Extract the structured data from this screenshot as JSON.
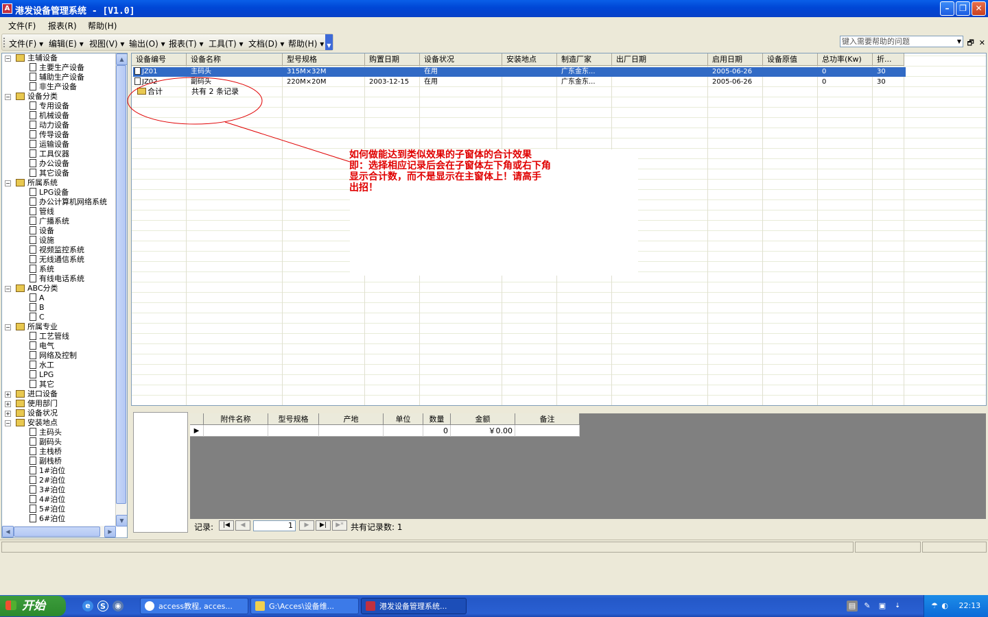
{
  "window": {
    "title": "港发设备管理系统 - [V1.0]",
    "app_icon_glyph": "A"
  },
  "menubar": {
    "items": [
      "文件(F)",
      "报表(R)",
      "帮助(H)"
    ],
    "help_placeholder": "键入需要帮助的问题"
  },
  "toolbar": {
    "items": [
      "文件(F)",
      "编辑(E)",
      "视图(V)",
      "输出(O)",
      "报表(T)",
      "工具(T)",
      "文档(D)",
      "帮助(H)"
    ]
  },
  "tree": [
    {
      "label": "主辅设备",
      "type": "folder",
      "expanded": true
    },
    {
      "label": "主要生产设备",
      "type": "doc"
    },
    {
      "label": "辅助生产设备",
      "type": "doc"
    },
    {
      "label": "非生产设备",
      "type": "doc"
    },
    {
      "label": "设备分类",
      "type": "folder",
      "expanded": true
    },
    {
      "label": "专用设备",
      "type": "doc"
    },
    {
      "label": "机械设备",
      "type": "doc"
    },
    {
      "label": "动力设备",
      "type": "doc"
    },
    {
      "label": "传导设备",
      "type": "doc"
    },
    {
      "label": "运输设备",
      "type": "doc"
    },
    {
      "label": "工具仪器",
      "type": "doc"
    },
    {
      "label": "办公设备",
      "type": "doc"
    },
    {
      "label": "其它设备",
      "type": "doc"
    },
    {
      "label": "所属系统",
      "type": "folder",
      "expanded": true
    },
    {
      "label": "LPG设备",
      "type": "doc"
    },
    {
      "label": "办公计算机网络系统",
      "type": "doc"
    },
    {
      "label": "管线",
      "type": "doc"
    },
    {
      "label": "广播系统",
      "type": "doc"
    },
    {
      "label": "设备",
      "type": "doc"
    },
    {
      "label": "设施",
      "type": "doc"
    },
    {
      "label": "视频监控系统",
      "type": "doc"
    },
    {
      "label": "无线通信系统",
      "type": "doc"
    },
    {
      "label": "系统",
      "type": "doc"
    },
    {
      "label": "有线电话系统",
      "type": "doc"
    },
    {
      "label": "ABC分类",
      "type": "folder",
      "expanded": true
    },
    {
      "label": "A",
      "type": "doc"
    },
    {
      "label": "B",
      "type": "doc"
    },
    {
      "label": "C",
      "type": "doc"
    },
    {
      "label": "所属专业",
      "type": "folder",
      "expanded": true
    },
    {
      "label": "工艺管线",
      "type": "doc"
    },
    {
      "label": "电气",
      "type": "doc"
    },
    {
      "label": "网络及控制",
      "type": "doc"
    },
    {
      "label": "水工",
      "type": "doc"
    },
    {
      "label": "LPG",
      "type": "doc"
    },
    {
      "label": "其它",
      "type": "doc"
    },
    {
      "label": "进口设备",
      "type": "folder",
      "expanded": false
    },
    {
      "label": "使用部门",
      "type": "folder",
      "expanded": false
    },
    {
      "label": "设备状况",
      "type": "folder",
      "expanded": false
    },
    {
      "label": "安装地点",
      "type": "folder",
      "expanded": true
    },
    {
      "label": "主码头",
      "type": "doc"
    },
    {
      "label": "副码头",
      "type": "doc"
    },
    {
      "label": "主栈桥",
      "type": "doc"
    },
    {
      "label": "副栈桥",
      "type": "doc"
    },
    {
      "label": "1#泊位",
      "type": "doc"
    },
    {
      "label": "2#泊位",
      "type": "doc"
    },
    {
      "label": "3#泊位",
      "type": "doc"
    },
    {
      "label": "4#泊位",
      "type": "doc"
    },
    {
      "label": "5#泊位",
      "type": "doc"
    },
    {
      "label": "6#泊位",
      "type": "doc"
    }
  ],
  "grid": {
    "columns": [
      "设备编号",
      "设备名称",
      "型号规格",
      "购置日期",
      "设备状况",
      "安装地点",
      "制造厂家",
      "出厂日期",
      "启用日期",
      "设备原值",
      "总功率(Kw)",
      "折..."
    ],
    "rows": [
      [
        "JZ01",
        "主码头",
        "315M×32M",
        "",
        "在用",
        "",
        "广东金东...",
        "",
        "2005-06-26",
        "",
        "0",
        "30"
      ],
      [
        "JZ02",
        "副码头",
        "220M×20M",
        "2003-12-15",
        "在用",
        "",
        "广东金东...",
        "",
        "2005-06-26",
        "",
        "0",
        "30"
      ]
    ],
    "total_label": "合计",
    "total_text": "共有 2 条记录"
  },
  "annotation": {
    "lines": [
      "如何做能达到类似效果的子窗体的合计效果",
      "即：选择相应记录后会在子窗体左下角或右下角",
      "显示合计数，而不是显示在主窗体上！请高手",
      "出招！"
    ],
    "color": "#e00000"
  },
  "subform": {
    "columns": [
      "附件名称",
      "型号规格",
      "产地",
      "单位",
      "数量",
      "金额",
      "备注"
    ],
    "row": [
      "",
      "",
      "",
      "",
      "0",
      "￥0.00",
      ""
    ]
  },
  "recnav": {
    "label": "记录:",
    "first": "|◀",
    "prev": "◀",
    "current": "1",
    "next": "▶",
    "last": "▶|",
    "new": "▶*",
    "total_text": "共有记录数: 1"
  },
  "taskbar": {
    "start": "开始",
    "items": [
      "access教程, acces...",
      "G:\\Acces\\设备维...",
      "港发设备管理系统..."
    ],
    "time": "22:13"
  },
  "colors": {
    "titlebar": "#0046d5",
    "selection": "#316ac5",
    "subform_bg": "#808080",
    "taskbar": "#245edb"
  }
}
